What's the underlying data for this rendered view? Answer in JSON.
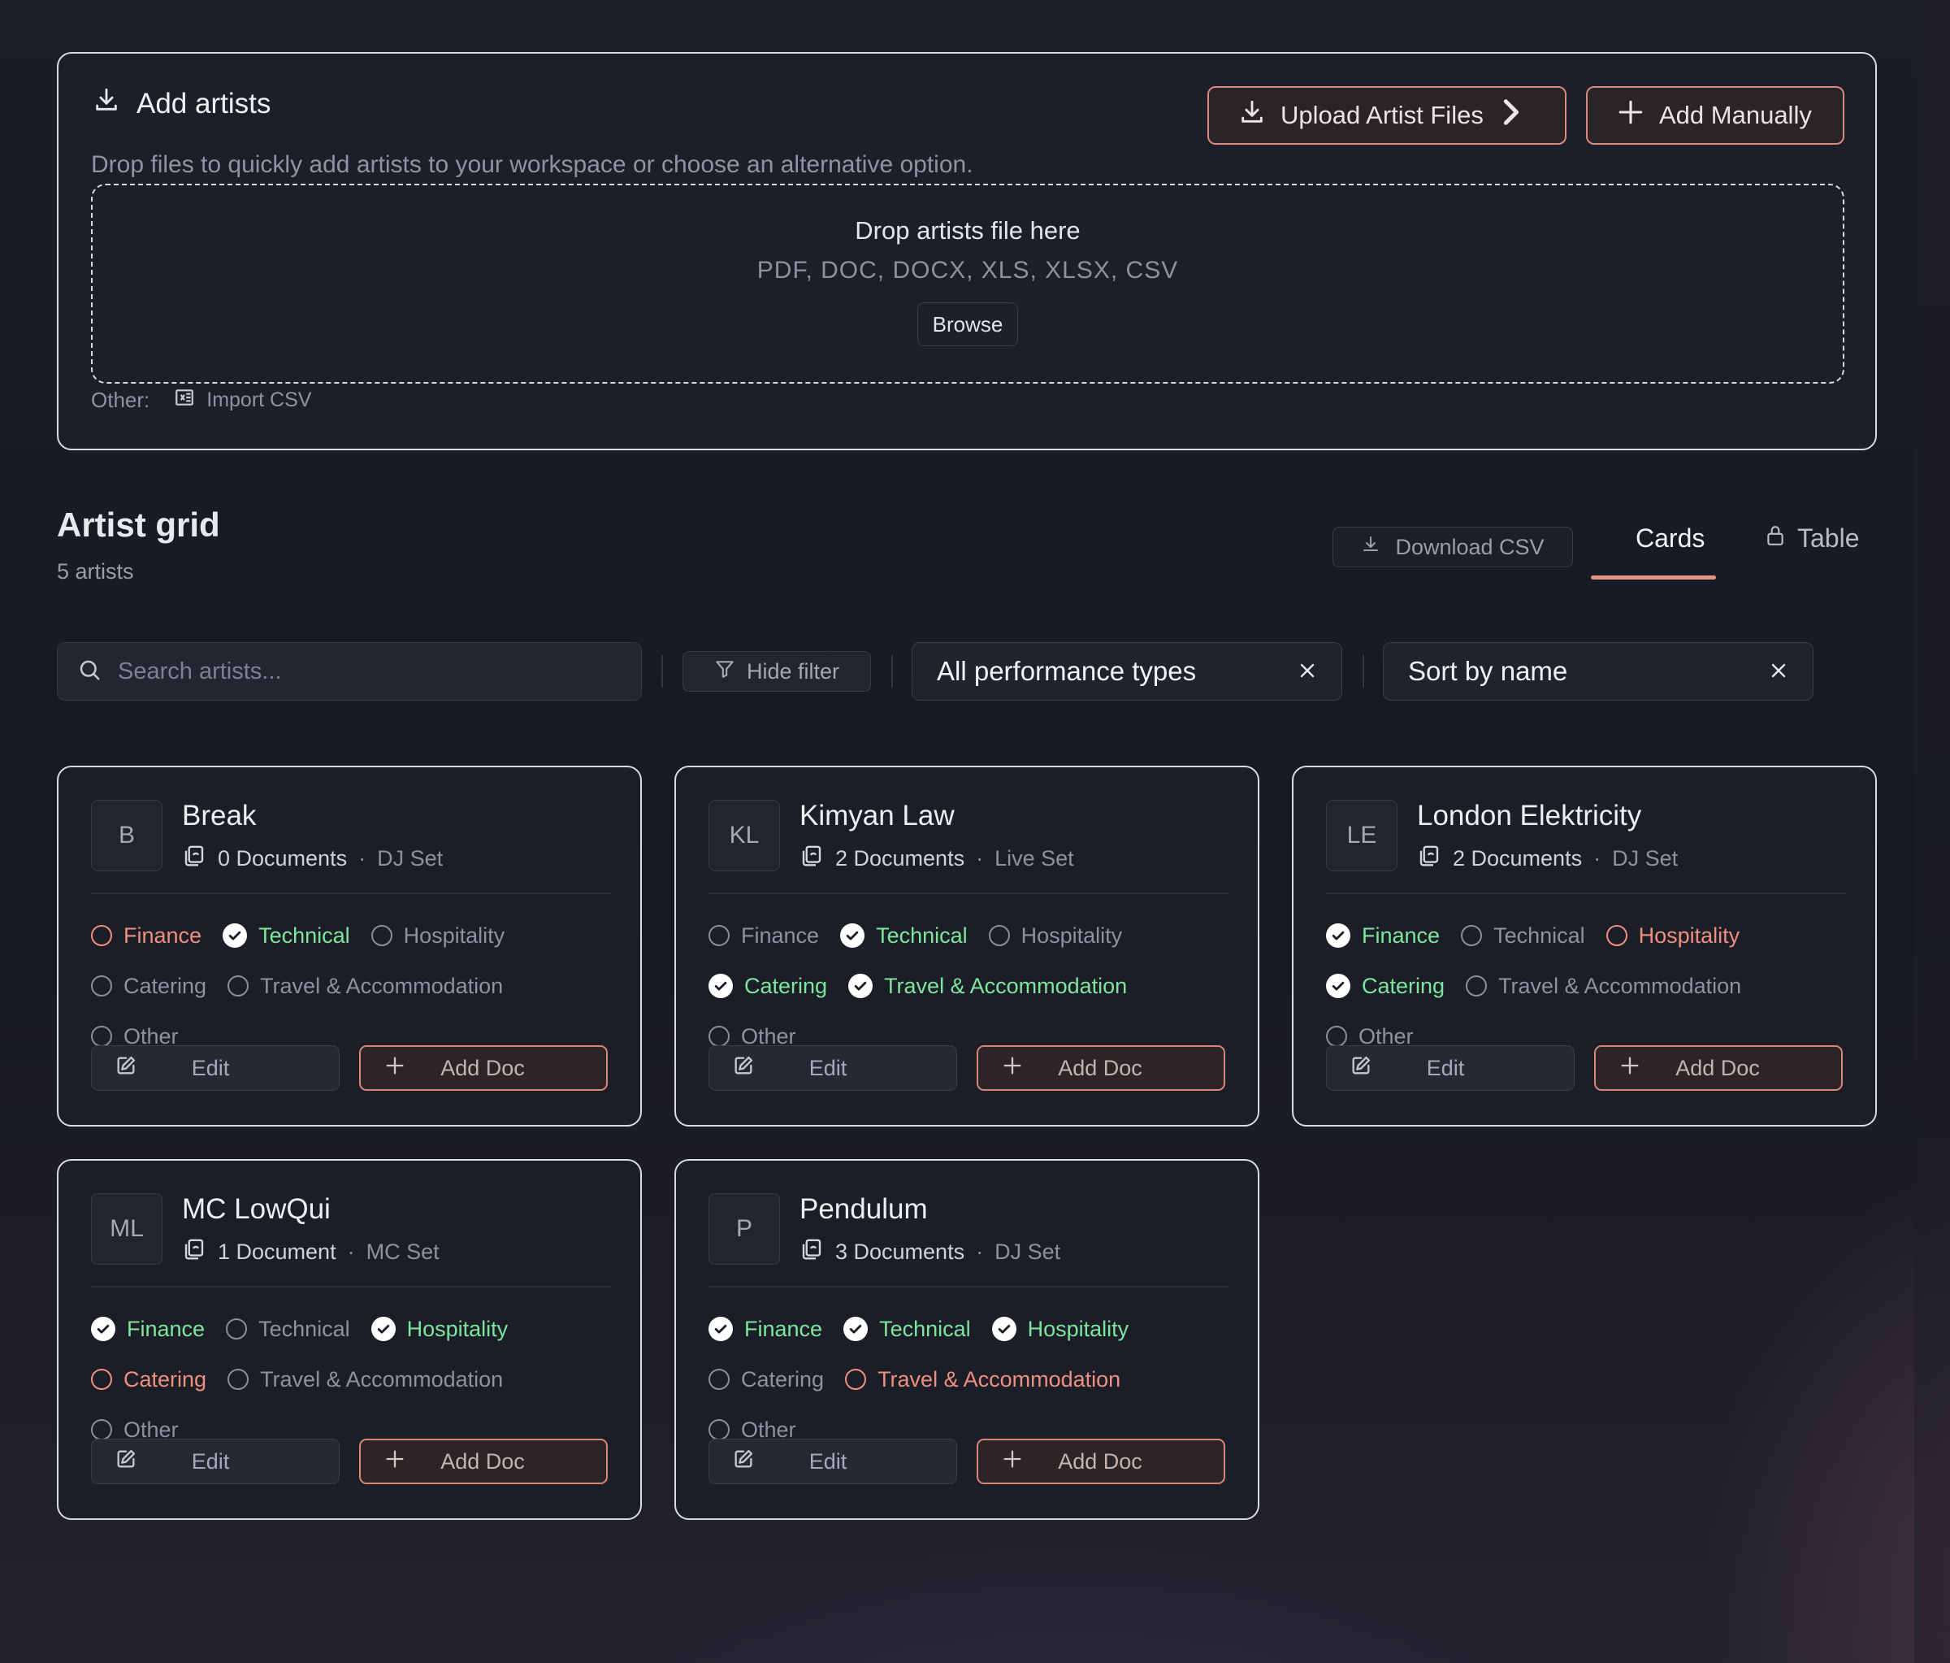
{
  "upload_panel": {
    "title": "Add artists",
    "description": "Drop files to quickly add artists to your workspace or choose an alternative option.",
    "upload_button": "Upload Artist Files",
    "manual_button": "Add Manually",
    "dropzone_title": "Drop artists file here",
    "dropzone_types": "PDF, DOC, DOCX, XLS, XLSX, CSV",
    "browse_button": "Browse",
    "other_label": "Other:",
    "import_csv": "Import CSV"
  },
  "grid": {
    "title": "Artist grid",
    "count": "5 artists",
    "download_csv": "Download CSV",
    "tab_cards": "Cards",
    "tab_table": "Table",
    "active_tab": "Cards"
  },
  "filters": {
    "search_placeholder": "Search artists...",
    "hide_filter": "Hide filter",
    "performance_type": "All performance types",
    "sort": "Sort by name"
  },
  "colors": {
    "accent": "#e59484",
    "done": "#7ee59e",
    "missing": "#ee8f80"
  },
  "card_labels": {
    "edit": "Edit",
    "add_doc": "Add Doc"
  },
  "artists": [
    {
      "initials": "B",
      "name": "Break",
      "documents": "0 Documents",
      "set": "DJ Set",
      "tags": [
        {
          "label": "Finance",
          "status": "missing"
        },
        {
          "label": "Technical",
          "status": "done"
        },
        {
          "label": "Hospitality",
          "status": "none"
        },
        {
          "label": "Catering",
          "status": "none"
        },
        {
          "label": "Travel & Accommodation",
          "status": "none"
        },
        {
          "label": "Other",
          "status": "none"
        }
      ]
    },
    {
      "initials": "KL",
      "name": "Kimyan Law",
      "documents": "2 Documents",
      "set": "Live Set",
      "tags": [
        {
          "label": "Finance",
          "status": "none"
        },
        {
          "label": "Technical",
          "status": "done"
        },
        {
          "label": "Hospitality",
          "status": "none"
        },
        {
          "label": "Catering",
          "status": "done"
        },
        {
          "label": "Travel & Accommodation",
          "status": "done"
        },
        {
          "label": "Other",
          "status": "none"
        }
      ]
    },
    {
      "initials": "LE",
      "name": "London Elektricity",
      "documents": "2 Documents",
      "set": "DJ Set",
      "tags": [
        {
          "label": "Finance",
          "status": "done"
        },
        {
          "label": "Technical",
          "status": "none"
        },
        {
          "label": "Hospitality",
          "status": "missing"
        },
        {
          "label": "Catering",
          "status": "done"
        },
        {
          "label": "Travel & Accommodation",
          "status": "none"
        },
        {
          "label": "Other",
          "status": "none"
        }
      ]
    },
    {
      "initials": "ML",
      "name": "MC LowQui",
      "documents": "1 Document",
      "set": "MC Set",
      "tags": [
        {
          "label": "Finance",
          "status": "done"
        },
        {
          "label": "Technical",
          "status": "none"
        },
        {
          "label": "Hospitality",
          "status": "done"
        },
        {
          "label": "Catering",
          "status": "missing"
        },
        {
          "label": "Travel & Accommodation",
          "status": "none"
        },
        {
          "label": "Other",
          "status": "none"
        }
      ]
    },
    {
      "initials": "P",
      "name": "Pendulum",
      "documents": "3 Documents",
      "set": "DJ Set",
      "tags": [
        {
          "label": "Finance",
          "status": "done"
        },
        {
          "label": "Technical",
          "status": "done"
        },
        {
          "label": "Hospitality",
          "status": "done"
        },
        {
          "label": "Catering",
          "status": "none"
        },
        {
          "label": "Travel & Accommodation",
          "status": "missing"
        },
        {
          "label": "Other",
          "status": "none"
        }
      ]
    }
  ]
}
